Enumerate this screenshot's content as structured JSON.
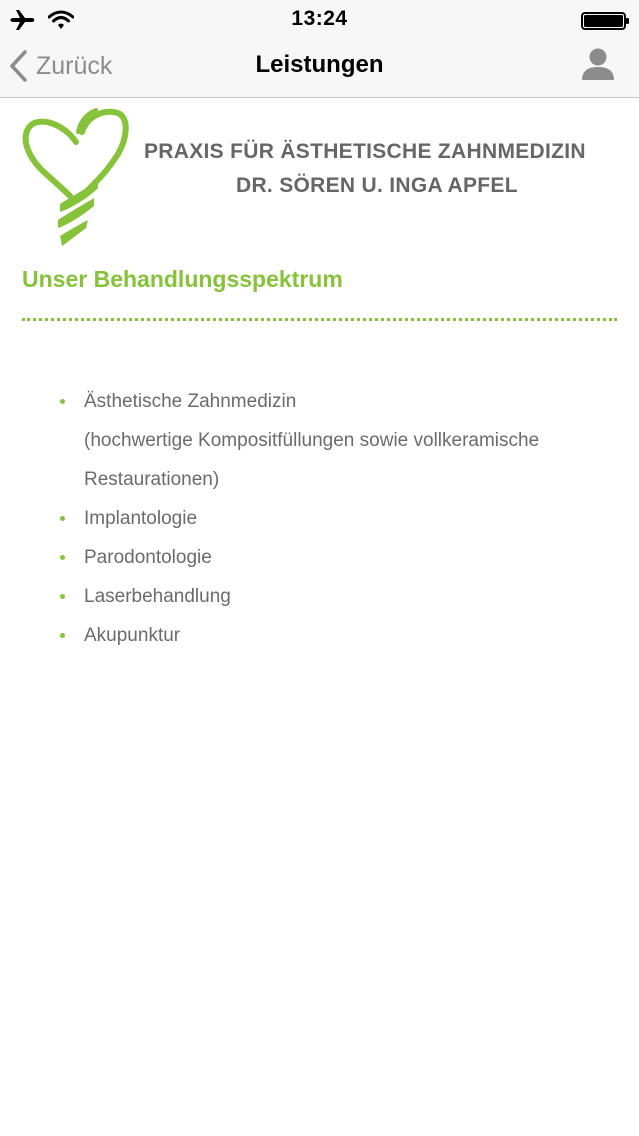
{
  "status_bar": {
    "time": "13:24",
    "icons": [
      "airplane-icon",
      "wifi-icon",
      "battery-icon"
    ]
  },
  "nav": {
    "back_label": "Zurück",
    "title": "Leistungen",
    "right_icon": "user-icon"
  },
  "logo": {
    "line1": "PRAXIS FÜR ÄSTHETISCHE ZAHNMEDIZIN",
    "line2": "DR. SÖREN U. INGA APFEL"
  },
  "section": {
    "title": "Unser Behandlungsspektrum"
  },
  "services": [
    {
      "label": "Ästhetische Zahnmedizin",
      "detail": "(hochwertige Kompositfüllungen sowie vollkeramische Restaurationen)"
    },
    {
      "label": "Implantologie"
    },
    {
      "label": "Parodontologie"
    },
    {
      "label": "Laserbehandlung"
    },
    {
      "label": "Akupunktur"
    }
  ],
  "colors": {
    "accent": "#86c23a",
    "body_text": "#6b6b6b",
    "logo_text": "#666666",
    "bar_background": "#f7f7f7"
  }
}
